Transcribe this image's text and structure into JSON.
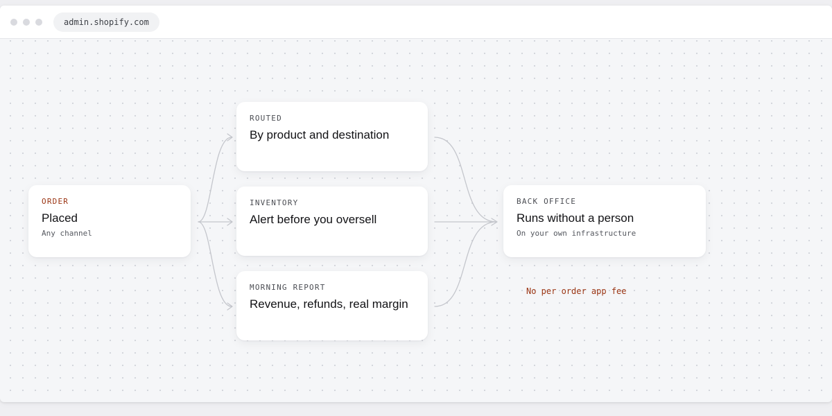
{
  "browser": {
    "url": "admin.shopify.com"
  },
  "flow": {
    "order": {
      "eyebrow": "ORDER",
      "title": "Placed",
      "subtitle": "Any channel"
    },
    "routed": {
      "eyebrow": "ROUTED",
      "title": "By product and destination"
    },
    "inventory": {
      "eyebrow": "INVENTORY",
      "title": "Alert before you oversell"
    },
    "morning_report": {
      "eyebrow": "MORNING REPORT",
      "title": "Revenue, refunds, real margin"
    },
    "back_office": {
      "eyebrow": "BACK OFFICE",
      "title": "Runs without a person",
      "subtitle": "On your own infrastructure"
    },
    "note": "No per order app fee"
  },
  "colors": {
    "accent": "#9a3412",
    "connector": "#c4c6cc",
    "card": "#ffffff",
    "canvas": "#f5f6f8"
  }
}
